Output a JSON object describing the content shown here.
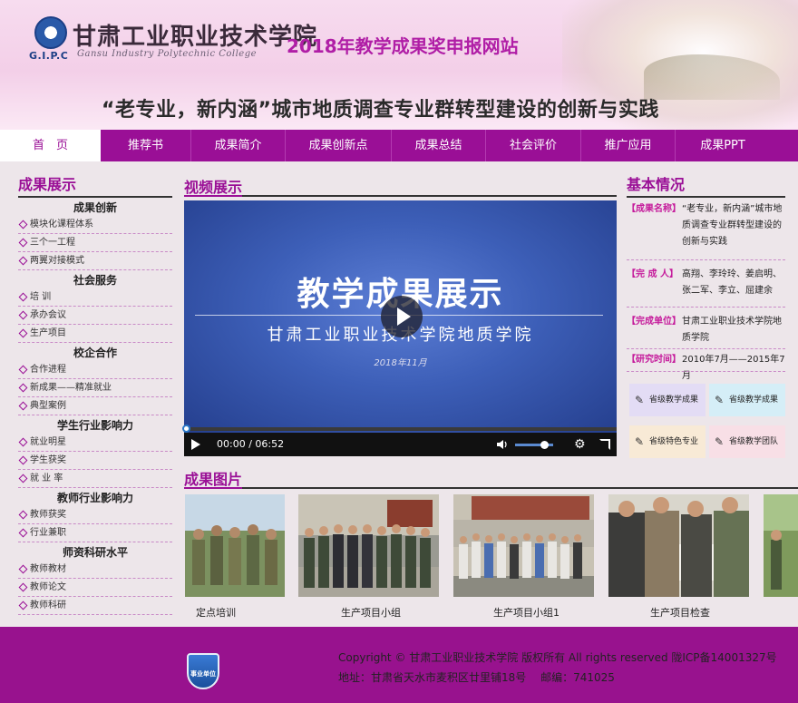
{
  "header": {
    "logo_abbr": "G.I.P.C",
    "logo_cn": "甘肃工业职业技术学院",
    "logo_en": "Gansu Industry Polytechnic College",
    "site_title": "2018年教学成果奖申报网站",
    "project_title": "“老专业，新内涵”城市地质调查专业群转型建设的创新与实践"
  },
  "nav": {
    "items": [
      "首　页",
      "推荐书",
      "成果简介",
      "成果创新点",
      "成果总结",
      "社会评价",
      "推广应用",
      "成果PPT"
    ]
  },
  "left": {
    "title": "成果展示",
    "groups": [
      {
        "name": "成果创新",
        "items": [
          "模块化课程体系",
          "三个一工程",
          "两翼对接模式"
        ]
      },
      {
        "name": "社会服务",
        "items": [
          "培 训",
          "承办会议",
          "生产项目"
        ]
      },
      {
        "name": "校企合作",
        "items": [
          "合作进程",
          "新成果——精准就业",
          "典型案例"
        ]
      },
      {
        "name": "学生行业影响力",
        "items": [
          "就业明星",
          "学生获奖",
          "就 业 率"
        ]
      },
      {
        "name": "教师行业影响力",
        "items": [
          "教师获奖",
          "行业兼职"
        ]
      },
      {
        "name": "师资科研水平",
        "items": [
          "教师教材",
          "教师论文",
          "教师科研"
        ]
      }
    ]
  },
  "video": {
    "title": "视频展示",
    "slide_title": "教学成果展示",
    "slide_sub": "甘肃工业职业技术学院地质学院",
    "slide_date": "2018年11月",
    "time": "00:00 / 06:52",
    "progress": 0,
    "volume": 0.75
  },
  "right": {
    "title": "基本情况",
    "rows": [
      {
        "label": "【成果名称】",
        "value": "“老专业，新内涵”城市地质调查专业群转型建设的创新与实践"
      },
      {
        "label": "【完 成 人】",
        "value": "高翔、李玲玲、姜启明、张二军、李立、屈建余"
      },
      {
        "label": "【完成单位】",
        "value": "甘肃工业职业技术学院地质学院"
      },
      {
        "label": "【研究时间】",
        "value": "2010年7月——2015年7月"
      }
    ],
    "badges": [
      "省级教学成果奖一",
      "省级教学成果奖二",
      "省级特色专业",
      "省级教学团队"
    ],
    "badge_colors": [
      "#e3dcf5",
      "#d5eef7",
      "#f8ead6",
      "#f8dfe6"
    ]
  },
  "photos": {
    "title": "成果图片",
    "items": [
      {
        "caption": "定点培训"
      },
      {
        "caption": "生产项目小组"
      },
      {
        "caption": "生产项目小组1"
      },
      {
        "caption": "生产项目检查"
      }
    ]
  },
  "footer": {
    "emblem_text": "事业单位",
    "line1": "Copyright © 甘肃工业职业技术学院 版权所有 All rights reserved 陇ICP备14001327号",
    "line2": "地址：甘肃省天水市麦积区廿里铺18号　 邮编：741025"
  },
  "colors": {
    "accent": "#9a0f96",
    "label": "#c51a9b",
    "header_bg": "#f3cfe8"
  }
}
